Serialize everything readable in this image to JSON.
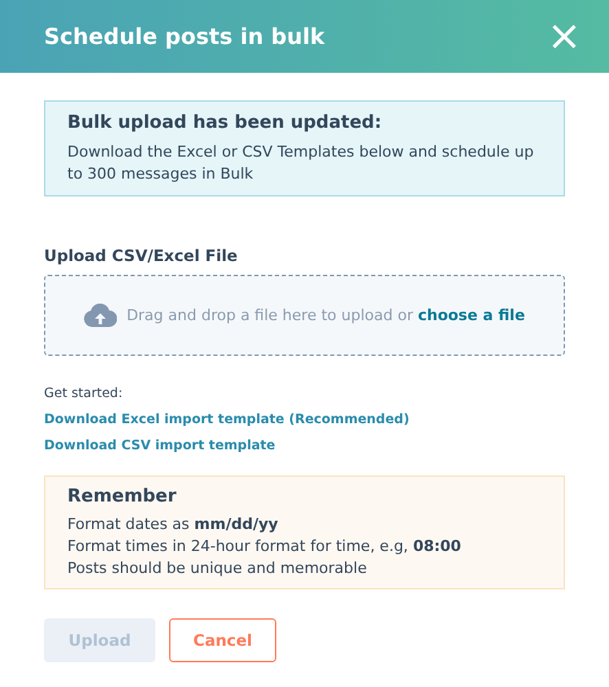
{
  "window": {
    "title": "Schedule posts in bulk",
    "close": "×"
  },
  "notice": {
    "title": "Bulk upload has been updated:",
    "text": "Download the Excel or CSV Templates below and schedule up to 300 messages in Bulk"
  },
  "upload": {
    "label": "Upload CSV/Excel File",
    "text": "Drag and drop a file here to upload or",
    "link": "choose a file"
  },
  "get_started": {
    "label": "Get started:",
    "links": [
      "Download Excel import template (Recommended)",
      "Download CSV import template"
    ]
  },
  "remember": {
    "title": "Remember",
    "lines": [
      "Format dates as **mm/dd/yy**",
      "Format times in 24-hour format for time, e.g, **08:00**",
      "Posts should be unique and memorable"
    ]
  },
  "buttons": [
    {
      "label": "Upload",
      "kind": "primary",
      "disabled": true
    },
    {
      "label": "Cancel",
      "kind": "secondary",
      "disabled": false
    }
  ]
}
